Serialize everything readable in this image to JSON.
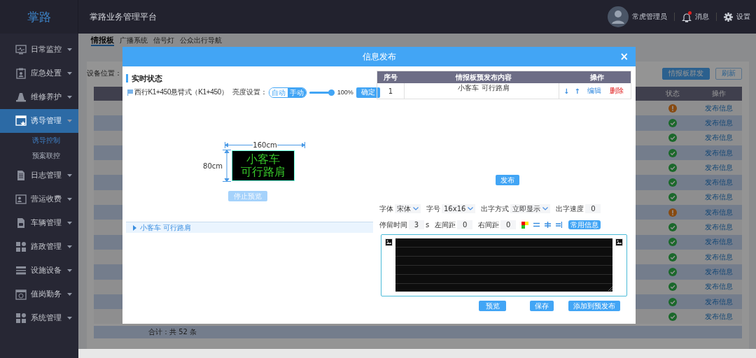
{
  "header": {
    "logo": "掌路",
    "title": "掌路业务管理平台",
    "user": "常虎管理员",
    "messages": "消息",
    "has_unread": true,
    "settings": "设置"
  },
  "sidebar": {
    "items": [
      {
        "label": "日常监控",
        "selected": false
      },
      {
        "label": "应急处置",
        "selected": false
      },
      {
        "label": "维修养护",
        "selected": false
      },
      {
        "label": "诱导管理",
        "selected": true,
        "children": [
          {
            "label": "诱导控制",
            "selected": true
          },
          {
            "label": "预案联控",
            "selected": false
          }
        ]
      },
      {
        "label": "日志管理",
        "selected": false
      },
      {
        "label": "营运收费",
        "selected": false
      },
      {
        "label": "车辆管理",
        "selected": false
      },
      {
        "label": "路政管理",
        "selected": false
      },
      {
        "label": "设施设备",
        "selected": false
      },
      {
        "label": "值岗勤务",
        "selected": false
      },
      {
        "label": "系统管理",
        "selected": false
      }
    ]
  },
  "page": {
    "tabs": [
      {
        "label": "情报板",
        "selected": true
      },
      {
        "label": "广播系统",
        "selected": false
      },
      {
        "label": "信号灯",
        "selected": false
      },
      {
        "label": "公众出行导航",
        "selected": false
      }
    ],
    "location_label": "设备位置：",
    "buttons": [
      {
        "label": "情报板群发",
        "kind": "primary"
      },
      {
        "label": "刷新",
        "kind": "outline"
      }
    ],
    "table": {
      "columns": [
        "状态",
        "操作"
      ],
      "rows": [
        {
          "warning": true,
          "action": "发布信息"
        },
        {
          "warning": false,
          "action": "发布信息"
        },
        {
          "warning": false,
          "action": "发布信息"
        },
        {
          "warning": false,
          "action": "发布信息"
        },
        {
          "warning": false,
          "action": "发布信息"
        },
        {
          "warning": false,
          "action": "发布信息"
        },
        {
          "warning": false,
          "action": "发布信息"
        },
        {
          "warning": true,
          "action": "发布信息"
        },
        {
          "warning": false,
          "action": "发布信息"
        },
        {
          "warning": false,
          "action": "发布信息"
        },
        {
          "warning": false,
          "action": "发布信息"
        },
        {
          "warning": false,
          "action": "发布信息"
        },
        {
          "warning": false,
          "action": "发布信息"
        },
        {
          "warning": false,
          "action": "发布信息"
        },
        {
          "warning": false,
          "action": "发布信息"
        }
      ]
    },
    "total": "合计：共 52 条"
  },
  "dialog": {
    "title": "信息发布",
    "close": "×",
    "status_heading": "实时状态",
    "device": "西行K1+450悬臂式（K1+450）",
    "brightness_label": "亮度设置：",
    "brightness_modes": [
      {
        "label": "自动",
        "selected": false
      },
      {
        "label": "手动",
        "selected": true
      }
    ],
    "brightness": {
      "level": 1.0,
      "reading": "100%"
    },
    "confirm": "确定",
    "sign": {
      "width": "160cm",
      "height": "80cm",
      "lines": [
        "小客车",
        "可行路肩"
      ]
    },
    "stop_preview": {
      "label": "停止预览",
      "disabled": true
    },
    "messages": [
      {
        "text": "小客车 可行路肩"
      }
    ],
    "queue": {
      "columns": [
        "序号",
        "情报板预发布内容",
        "操作"
      ],
      "rows": [
        {
          "index": "1",
          "content": "小客车 可行路肩",
          "move_down": "↓",
          "move_up": "↑",
          "edit": "编辑",
          "delete": "删除"
        }
      ]
    },
    "publish": "发布",
    "form_rows": [
      [
        {
          "kind": "select",
          "label": "字体",
          "value": "宋体"
        },
        {
          "kind": "select",
          "label": "字号",
          "value": "16x16"
        },
        {
          "kind": "select",
          "label": "出字方式",
          "value": "立即显示"
        },
        {
          "kind": "input",
          "label": "出字速度",
          "value": "0"
        }
      ],
      [
        {
          "kind": "input",
          "label": "停留时间",
          "value": "3",
          "unit": "s"
        },
        {
          "kind": "input",
          "label": "左间距",
          "value": "0"
        },
        {
          "kind": "input",
          "label": "右间距",
          "value": "0"
        },
        {
          "kind": "colors"
        },
        {
          "kind": "align"
        },
        {
          "kind": "button",
          "label": "常用信息"
        }
      ]
    ],
    "actions": [
      "预览",
      "保存",
      "添加到预发布"
    ]
  }
}
